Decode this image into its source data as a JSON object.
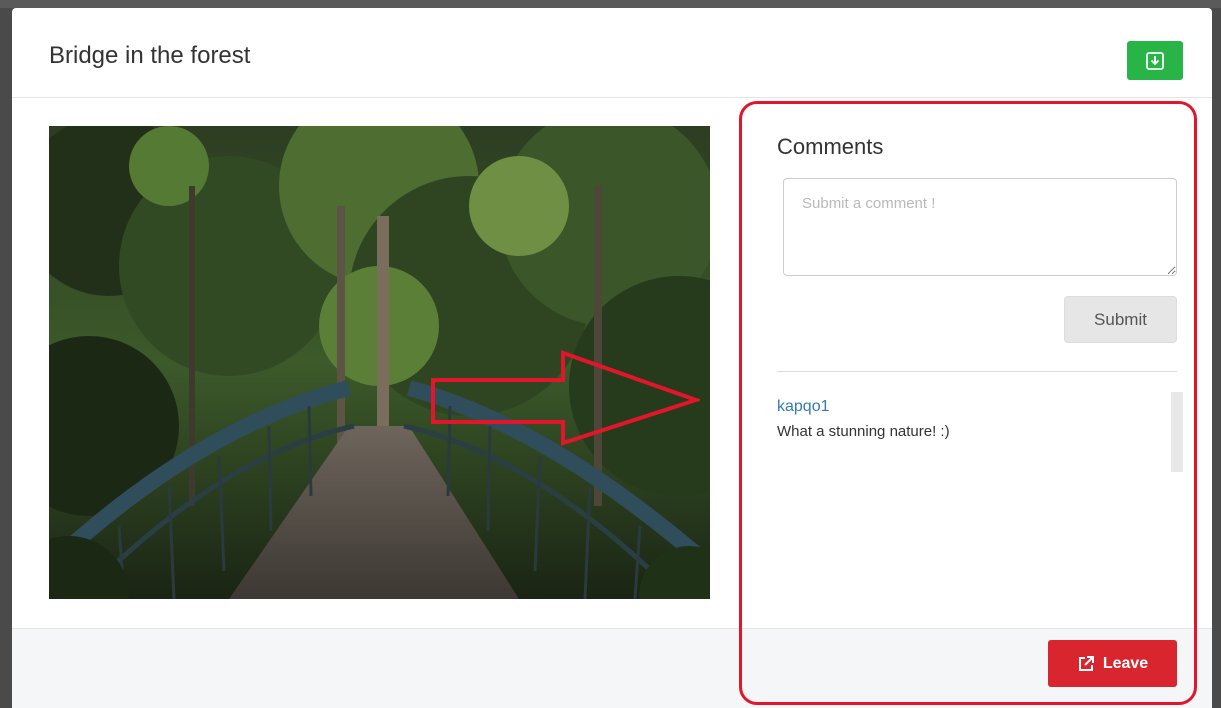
{
  "modal": {
    "title": "Bridge in the forest",
    "download_icon": "download-icon"
  },
  "comments": {
    "heading": "Comments",
    "input_placeholder": "Submit a comment !",
    "input_value": "",
    "submit_label": "Submit",
    "items": [
      {
        "user": "kapqo1",
        "text": "What a stunning nature! :)"
      }
    ]
  },
  "footer": {
    "leave_label": "Leave",
    "leave_icon": "external-link-icon"
  },
  "colors": {
    "download_green": "#28b446",
    "leave_red": "#d9262e",
    "link_blue": "#337ab7",
    "annotation_red": "#e3152b"
  }
}
